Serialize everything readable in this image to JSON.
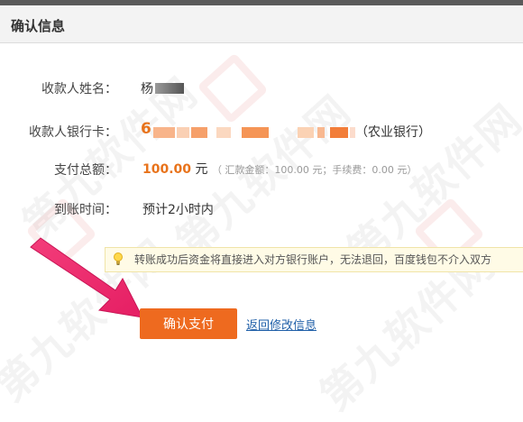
{
  "header": {
    "title": "确认信息"
  },
  "form": {
    "payee_name_label": "收款人姓名：",
    "payee_name_value": "杨",
    "payee_card_label": "收款人银行卡：",
    "payee_card_prefix": "6",
    "payee_card_bank": "（农业银行）",
    "amount_label": "支付总额：",
    "amount_value": "100.00",
    "amount_unit": "元",
    "amount_detail": "（ 汇款金额：100.00 元；手续费：0.00 元）",
    "arrival_label": "到账时间：",
    "arrival_value": "预计2小时内"
  },
  "notice": {
    "text": "转账成功后资金将直接进入对方银行账户，无法退回，百度钱包不介入双方"
  },
  "actions": {
    "pay_label": "确认支付",
    "back_label": "返回修改信息"
  },
  "watermark": {
    "text": "第九软件网"
  },
  "colors": {
    "accent": "#ee6a1f",
    "link": "#1f5fa8",
    "arrow": "#f0306e"
  }
}
